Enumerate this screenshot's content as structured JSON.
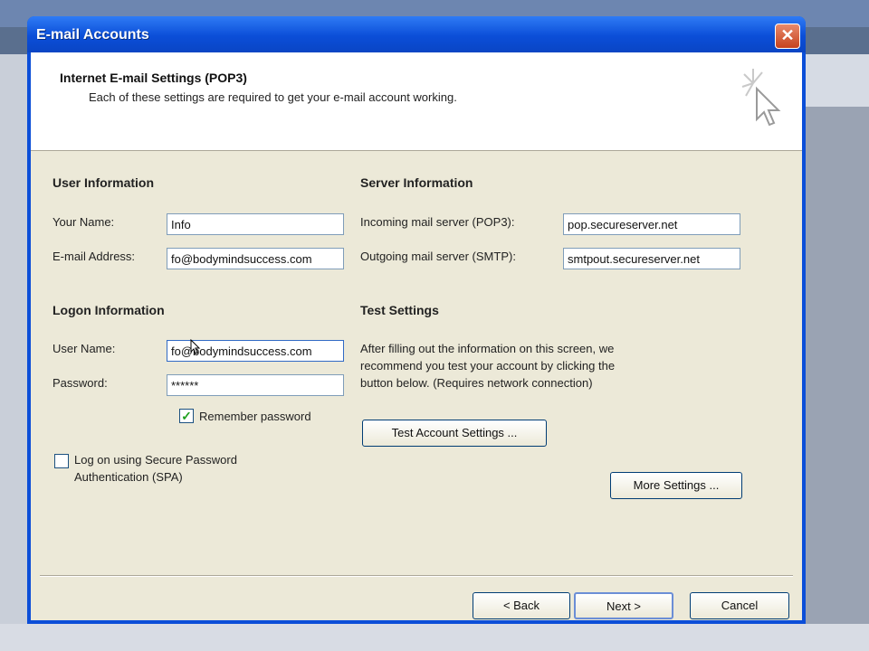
{
  "window": {
    "title": "E-mail Accounts",
    "close_symbol": "✕"
  },
  "header": {
    "title": "Internet E-mail Settings (POP3)",
    "subtitle": "Each of these settings are required to get your e-mail account working."
  },
  "user_info": {
    "heading": "User Information",
    "name_label": "Your Name:",
    "name_value": "Info",
    "email_label": "E-mail Address:",
    "email_value": "fo@bodymindsuccess.com"
  },
  "server_info": {
    "heading": "Server Information",
    "incoming_label": "Incoming mail server (POP3):",
    "incoming_value": "pop.secureserver.net",
    "outgoing_label": "Outgoing mail server (SMTP):",
    "outgoing_value": "smtpout.secureserver.net"
  },
  "logon_info": {
    "heading": "Logon Information",
    "username_label": "User Name:",
    "username_value": "fo@bodymindsuccess.com",
    "password_label": "Password:",
    "password_value": "******",
    "remember_label": "Remember password",
    "remember_checked": true,
    "spa_label_line1": "Log on using Secure Password",
    "spa_label_line2": "Authentication (SPA)",
    "spa_checked": false
  },
  "test_settings": {
    "heading": "Test Settings",
    "desc_line1": "After filling out the information on this screen, we",
    "desc_line2": "recommend you test your account by clicking the",
    "desc_line3": "button below. (Requires network connection)",
    "test_button": "Test Account Settings ...",
    "more_button": "More Settings ..."
  },
  "footer": {
    "back_button": "< Back",
    "next_button": "Next >",
    "cancel_button": "Cancel"
  },
  "colors": {
    "titlebar": "#0b4ed8",
    "client": "#ece9d8",
    "close": "#c6421e"
  }
}
